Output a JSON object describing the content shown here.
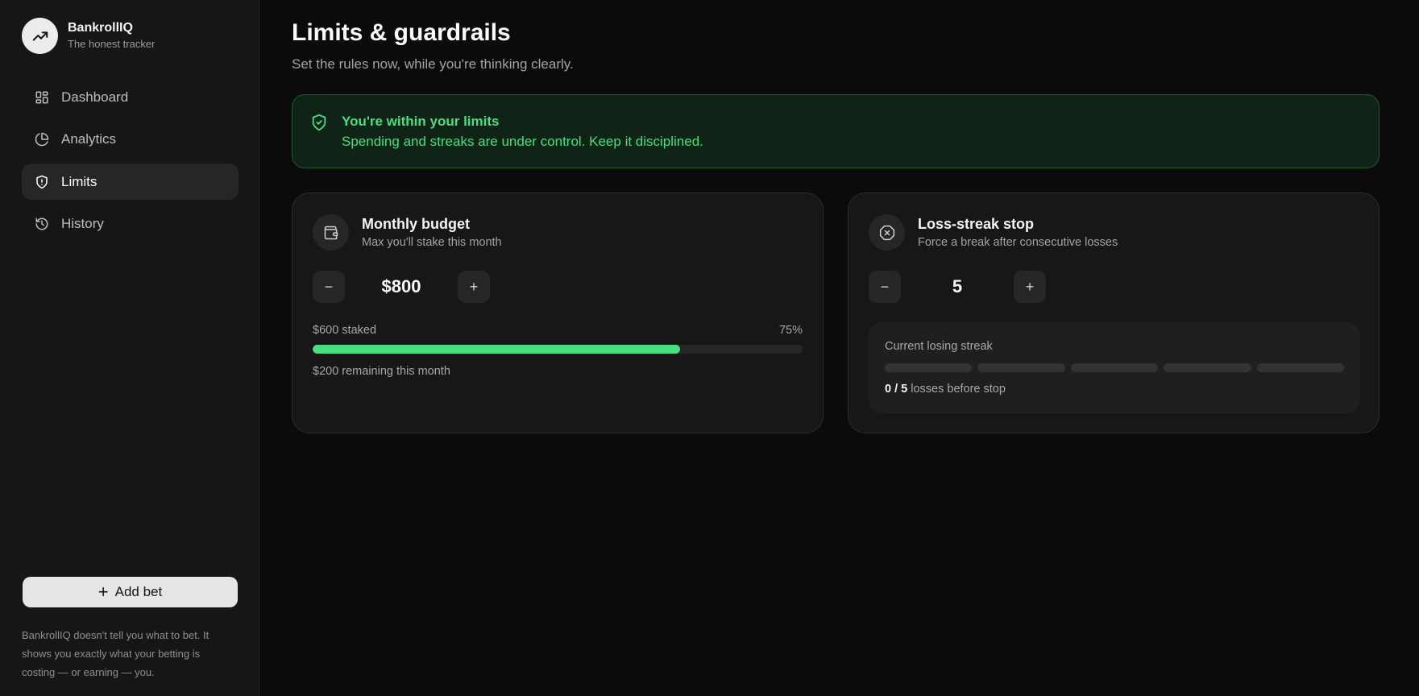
{
  "app": {
    "name": "BankrollIQ",
    "tagline": "The honest tracker"
  },
  "sidebar": {
    "items": [
      {
        "label": "Dashboard",
        "icon": "dashboard-icon",
        "active": false
      },
      {
        "label": "Analytics",
        "icon": "pie-chart-icon",
        "active": false
      },
      {
        "label": "Limits",
        "icon": "shield-icon",
        "active": true
      },
      {
        "label": "History",
        "icon": "history-icon",
        "active": false
      }
    ],
    "add_bet_label": "Add bet",
    "footnote": "BankrollIQ doesn't tell you what to bet. It shows you exactly what your betting is costing — or earning — you."
  },
  "page": {
    "title": "Limits & guardrails",
    "subtitle": "Set the rules now, while you're thinking clearly."
  },
  "status": {
    "title": "You're within your limits",
    "text": "Spending and streaks are under control. Keep it disciplined.",
    "color": "#4ade80"
  },
  "budget": {
    "title": "Monthly budget",
    "subtitle": "Max you'll stake this month",
    "value": "$800",
    "staked_label": "$600 staked",
    "percent_label": "75%",
    "progress": 0.75,
    "remaining_label": "$200 remaining this month"
  },
  "streak": {
    "title": "Loss-streak stop",
    "subtitle": "Force a break after consecutive losses",
    "value": "5",
    "current_label": "Current losing streak",
    "current": 0,
    "max": 5,
    "count_label": "0 / 5",
    "count_suffix": "losses before stop"
  },
  "colors": {
    "accent": "#4ade80",
    "background": "#0b0b0b",
    "sidebar": "#161616"
  }
}
